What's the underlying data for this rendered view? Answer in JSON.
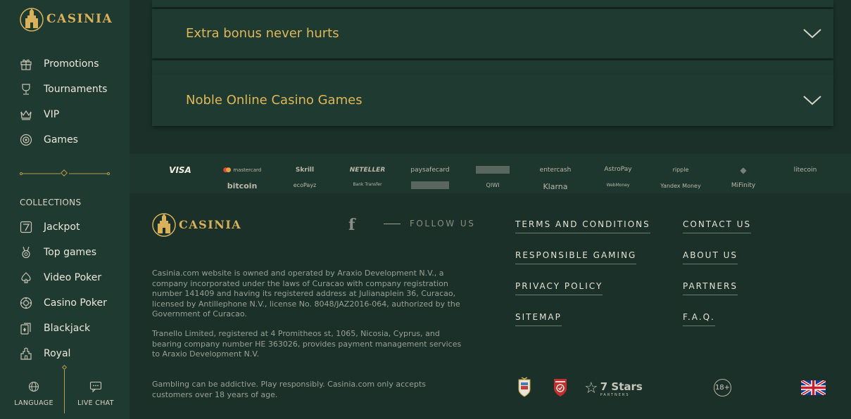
{
  "brand": {
    "name": "CASINIA"
  },
  "sidebar": {
    "items": [
      {
        "label": "Promotions",
        "icon": "gift-icon"
      },
      {
        "label": "Tournaments",
        "icon": "trophy-icon"
      },
      {
        "label": "VIP",
        "icon": "crown-icon"
      },
      {
        "label": "Games",
        "icon": "chip-icon"
      }
    ],
    "collections_title": "COLLECTIONS",
    "collections": [
      {
        "label": "Jackpot",
        "icon": "seven-icon"
      },
      {
        "label": "Top games",
        "icon": "medal-icon"
      },
      {
        "label": "Video Poker",
        "icon": "spade-icon"
      },
      {
        "label": "Casino Poker",
        "icon": "poker-chip-icon"
      },
      {
        "label": "Blackjack",
        "icon": "cards-icon"
      },
      {
        "label": "Royal",
        "icon": "castle-icon"
      }
    ],
    "bottom": {
      "language_label": "LANGUAGE",
      "live_chat_label": "LIVE CHAT"
    }
  },
  "accordions": [
    {
      "title": "Extra bonus never hurts"
    },
    {
      "title": "Noble Online Casino Games"
    }
  ],
  "payments": {
    "row1": [
      "VISA",
      "mastercard",
      "Skrill",
      "NETELLER",
      "paysafecard",
      "",
      "entercash",
      "AstroPay",
      "ripple",
      "",
      "litecoin"
    ],
    "row2": [
      "bitcoin",
      "ecoPayz",
      "Bank Transfer",
      "",
      "QIWI",
      "Klarna",
      "WebMoney",
      "Yandex Money",
      "MiFinity"
    ]
  },
  "footer": {
    "follow_us": "FOLLOW US",
    "links": {
      "terms": "TERMS AND CONDITIONS",
      "contact": "CONTACT US",
      "responsible": "RESPONSIBLE GAMING",
      "about": "ABOUT US",
      "privacy": "PRIVACY POLICY",
      "partners": "PARTNERS",
      "sitemap": "SITEMAP",
      "faq": "F.A.Q."
    },
    "legal1": "Casinia.com website is owned and operated by Araxio Development N.V., a company incorporated under the laws of Curacao with company registration number 141409 and having its registered address at Julianaplein 36, Curacao, licensed by Antillephone N.V., license No. 8048/JAZ2016-064, authorized by the Government of Curacao.",
    "legal2": "Tranello Limited, registered at 4 Promitheos st, 1065, Nicosia, Cyprus, and bearing company number HE 363026, provides payment management services to Araxio Development N.V.",
    "legal3": "Gambling can be addictive. Play responsibly. Casinia.com only accepts customers over 18 years of age.",
    "stars_brand": "7 Stars",
    "stars_sub": "PARTNERS",
    "age": "18+"
  },
  "colors": {
    "accent": "#dfb758",
    "bg": "#1a3028",
    "panel": "#1f3a31"
  }
}
